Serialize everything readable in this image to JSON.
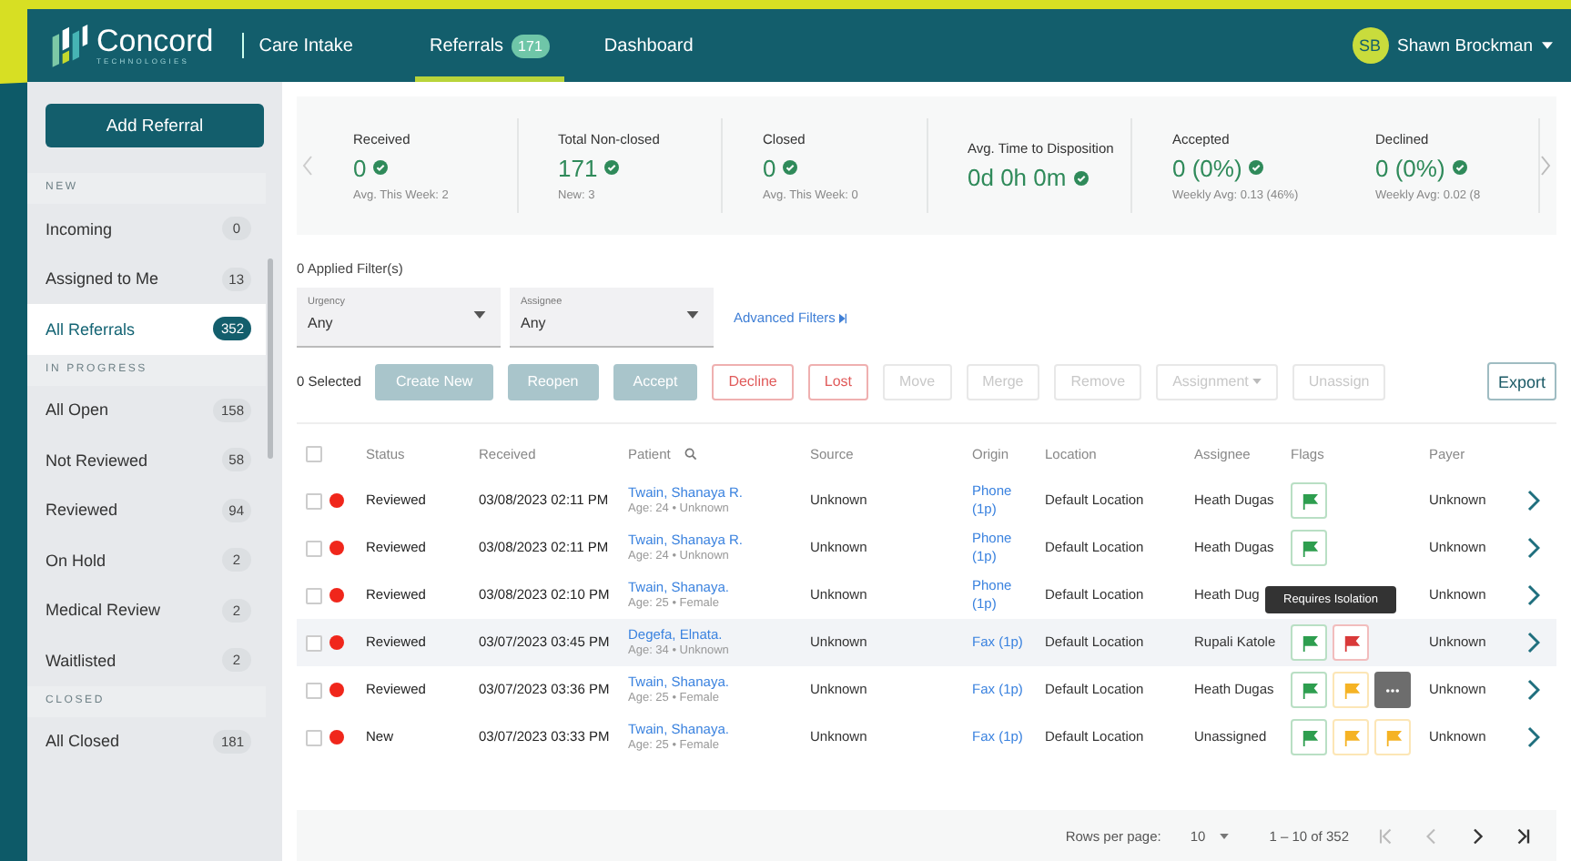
{
  "header": {
    "brand": "Concord",
    "brand_sub": "TECHNOLOGIES",
    "app_name": "Care Intake",
    "nav": [
      {
        "label": "Referrals",
        "badge": "171",
        "selected": true
      },
      {
        "label": "Dashboard",
        "selected": false
      }
    ],
    "user": {
      "initials": "SB",
      "name": "Shawn Brockman"
    }
  },
  "sidebar": {
    "add_button": "Add Referral",
    "sections": [
      {
        "title": "NEW",
        "items": [
          {
            "label": "Incoming",
            "count": "0",
            "selected": false
          },
          {
            "label": "Assigned to Me",
            "count": "13",
            "selected": false
          },
          {
            "label": "All Referrals",
            "count": "352",
            "selected": true
          }
        ]
      },
      {
        "title": "IN PROGRESS",
        "items": [
          {
            "label": "All Open",
            "count": "158",
            "selected": false
          },
          {
            "label": "Not Reviewed",
            "count": "58",
            "selected": false
          },
          {
            "label": "Reviewed",
            "count": "94",
            "selected": false
          },
          {
            "label": "On Hold",
            "count": "2",
            "selected": false
          },
          {
            "label": "Medical Review",
            "count": "2",
            "selected": false
          },
          {
            "label": "Waitlisted",
            "count": "2",
            "selected": false
          }
        ]
      },
      {
        "title": "CLOSED",
        "items": [
          {
            "label": "All Closed",
            "count": "181",
            "selected": false
          }
        ]
      }
    ]
  },
  "stats": [
    {
      "label": "Received",
      "value": "0",
      "sub": "Avg. This Week: 2"
    },
    {
      "label": "Total Non-closed",
      "value": "171",
      "sub": "New: 3"
    },
    {
      "label": "Closed",
      "value": "0",
      "sub": "Avg. This Week: 0"
    },
    {
      "label": "Avg. Time to Disposition",
      "value": "0d 0h 0m"
    },
    {
      "label": "Accepted",
      "value": "0 (0%)",
      "sub": "Weekly Avg: 0.13 (46%)"
    },
    {
      "label": "Declined",
      "value": "0 (0%)",
      "sub": "Weekly Avg: 0.02 (8"
    }
  ],
  "filters": {
    "applied": "0 Applied Filter(s)",
    "selects": [
      {
        "label": "Urgency",
        "value": "Any"
      },
      {
        "label": "Assignee",
        "value": "Any"
      }
    ],
    "advanced": "Advanced Filters"
  },
  "actions": {
    "selected": "0 Selected",
    "buttons": [
      {
        "label": "Create New",
        "kind": "solid"
      },
      {
        "label": "Reopen",
        "kind": "solid"
      },
      {
        "label": "Accept",
        "kind": "solid"
      },
      {
        "label": "Decline",
        "kind": "danger"
      },
      {
        "label": "Lost",
        "kind": "danger"
      },
      {
        "label": "Move",
        "kind": "muted"
      },
      {
        "label": "Merge",
        "kind": "muted"
      },
      {
        "label": "Remove",
        "kind": "muted"
      },
      {
        "label": "Assignment",
        "kind": "dropdown"
      },
      {
        "label": "Unassign",
        "kind": "muted"
      }
    ],
    "export": "Export"
  },
  "table": {
    "select_all_checked": false,
    "columns": [
      "Status",
      "Received",
      "Patient",
      "Source",
      "Origin",
      "Location",
      "Assignee",
      "Flags",
      "Payer"
    ],
    "rows": [
      {
        "checked": false,
        "status": "Reviewed",
        "received": "03/08/2023 02:11 PM",
        "patient": "Twain, Shanaya R.",
        "patient_info": "Age: 24 • Unknown",
        "source": "Unknown",
        "origin": "Phone (1p)",
        "location": "Default Location",
        "assignee": "Heath Dugas",
        "flags": [
          {
            "kind": "flag",
            "color": "#2e9e4f"
          }
        ],
        "payer": "Unknown",
        "highlighted": false
      },
      {
        "checked": false,
        "status": "Reviewed",
        "received": "03/08/2023 02:11 PM",
        "patient": "Twain, Shanaya R.",
        "patient_info": "Age: 24 • Unknown",
        "source": "Unknown",
        "origin": "Phone (1p)",
        "location": "Default Location",
        "assignee": "Heath Dugas",
        "flags": [
          {
            "kind": "flag",
            "color": "#2e9e4f"
          }
        ],
        "payer": "Unknown",
        "highlighted": false
      },
      {
        "checked": false,
        "status": "Reviewed",
        "received": "03/08/2023 02:10 PM",
        "patient": "Twain, Shanaya.",
        "patient_info": "Age: 25 • Female",
        "source": "Unknown",
        "origin": "Phone (1p)",
        "location": "Default Location",
        "assignee": "Heath Dug",
        "flags": [],
        "payer": "Unknown",
        "highlighted": false
      },
      {
        "checked": false,
        "status": "Reviewed",
        "received": "03/07/2023 03:45 PM",
        "patient": "Degefa, Elnata.",
        "patient_info": "Age: 34 • Unknown",
        "source": "Unknown",
        "origin": "Fax (1p)",
        "location": "Default Location",
        "assignee": "Rupali Katole",
        "flags": [
          {
            "kind": "flag",
            "color": "#2e9e4f"
          },
          {
            "kind": "flag",
            "color": "#d93a3a"
          }
        ],
        "payer": "Unknown",
        "highlighted": true
      },
      {
        "checked": false,
        "status": "Reviewed",
        "received": "03/07/2023 03:36 PM",
        "patient": "Twain, Shanaya.",
        "patient_info": "Age: 25 • Female",
        "source": "Unknown",
        "origin": "Fax (1p)",
        "location": "Default Location",
        "assignee": "Heath Dugas",
        "flags": [
          {
            "kind": "flag",
            "color": "#2e9e4f"
          },
          {
            "kind": "flag",
            "color": "#f5b325"
          },
          {
            "kind": "more"
          }
        ],
        "payer": "Unknown",
        "highlighted": false
      },
      {
        "checked": false,
        "status": "New",
        "received": "03/07/2023 03:33 PM",
        "patient": "Twain, Shanaya.",
        "patient_info": "Age: 25 • Female",
        "source": "Unknown",
        "origin": "Fax (1p)",
        "location": "Default Location",
        "assignee": "Unassigned",
        "flags": [
          {
            "kind": "flag",
            "color": "#2e9e4f"
          },
          {
            "kind": "flag",
            "color": "#f5b325"
          },
          {
            "kind": "flag",
            "color": "#f5b325"
          }
        ],
        "payer": "Unknown",
        "highlighted": false
      }
    ],
    "tooltip": "Requires Isolation"
  },
  "pagination": {
    "rows_label": "Rows per page:",
    "rows_value": "10",
    "range": "1 – 10 of 352"
  }
}
